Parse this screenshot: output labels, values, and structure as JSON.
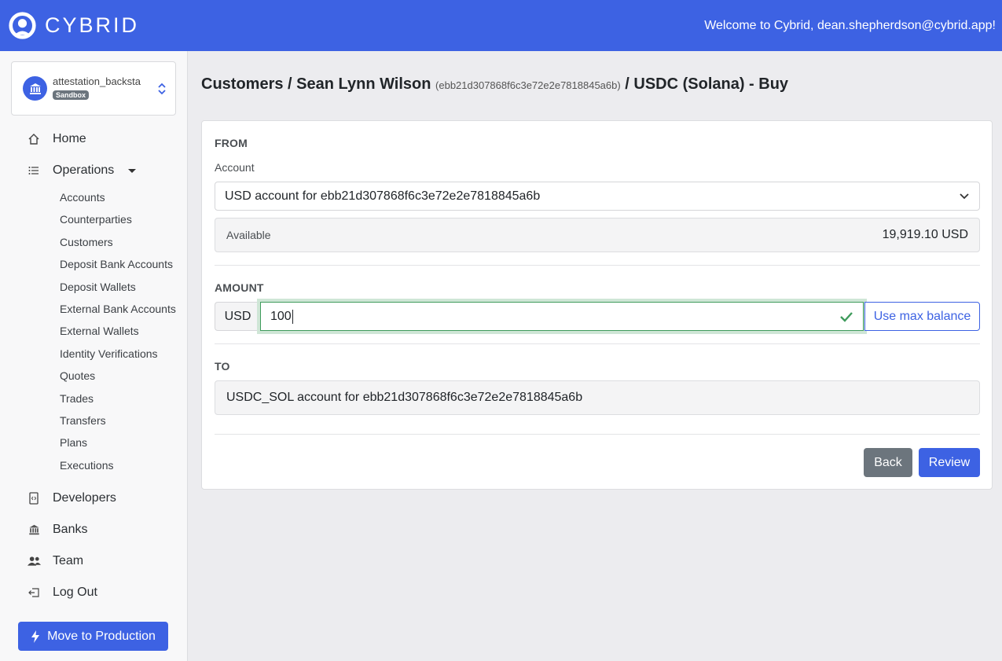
{
  "header": {
    "brand": "CYBRID",
    "welcome": "Welcome to Cybrid, dean.shepherdson@cybrid.app!"
  },
  "org": {
    "name": "attestation_backstage",
    "badge": "Sandbox"
  },
  "sidebar": {
    "home": "Home",
    "operations": "Operations",
    "operations_items": [
      "Accounts",
      "Counterparties",
      "Customers",
      "Deposit Bank Accounts",
      "Deposit Wallets",
      "External Bank Accounts",
      "External Wallets",
      "Identity Verifications",
      "Quotes",
      "Trades",
      "Transfers",
      "Plans",
      "Executions"
    ],
    "developers": "Developers",
    "banks": "Banks",
    "team": "Team",
    "logout": "Log Out",
    "move_to_production": "Move to Production"
  },
  "breadcrumb": {
    "part1": "Customers / Sean Lynn Wilson",
    "customer_id": "(ebb21d307868f6c3e72e2e7818845a6b)",
    "part2": "/ USDC (Solana) - Buy"
  },
  "form": {
    "from_label": "FROM",
    "account_label": "Account",
    "account_value": "USD account for ebb21d307868f6c3e72e2e7818845a6b",
    "available_label": "Available",
    "available_value": "19,919.10 USD",
    "amount_label": "AMOUNT",
    "currency": "USD",
    "amount_value": "100",
    "max_button": "Use max balance",
    "to_label": "TO",
    "to_value": "USDC_SOL account for ebb21d307868f6c3e72e2e7818845a6b",
    "back_button": "Back",
    "review_button": "Review"
  },
  "colors": {
    "brand": "#3d62e3",
    "success": "#3f9b5c",
    "secondary": "#6c757d"
  }
}
